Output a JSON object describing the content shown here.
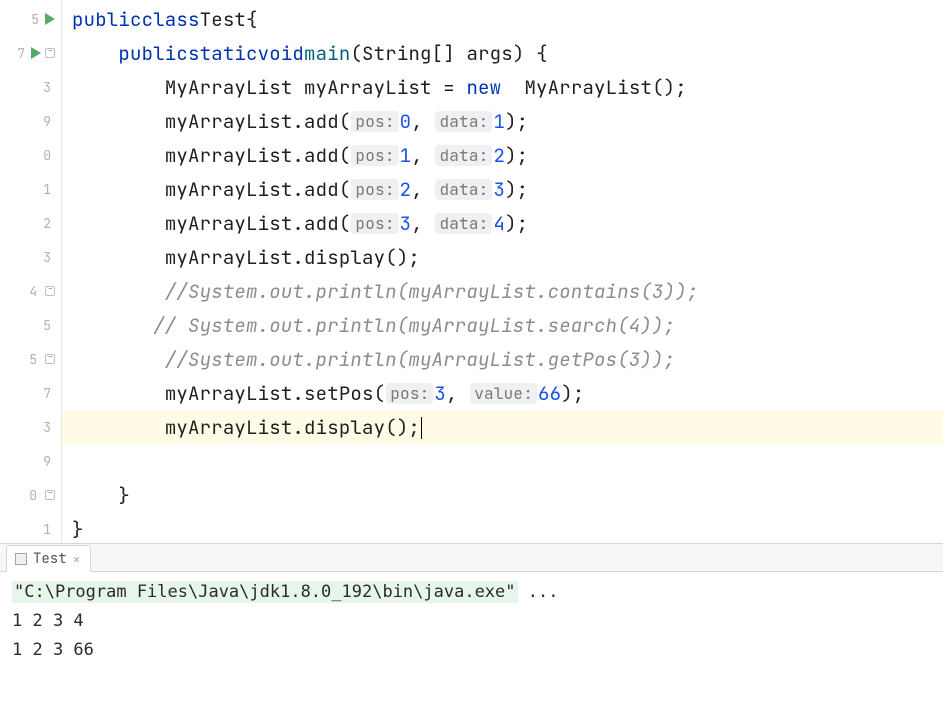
{
  "gutter": {
    "line_numbers": [
      "5",
      "7",
      "3",
      "9",
      "0",
      "1",
      "2",
      "3",
      "4",
      "5",
      "5",
      "7",
      "3",
      "9",
      "0",
      "1"
    ]
  },
  "code": {
    "l1": {
      "indent": "",
      "kw1": "public",
      "kw2": "class",
      "cls": "Test",
      "brace": "{"
    },
    "l2": {
      "indent": "    ",
      "kw1": "public",
      "kw2": "static",
      "kw3": "void",
      "mtd": "main",
      "open": "(",
      "typ": "String",
      "arr": "[] ",
      "par": "args",
      "close": ")",
      "brace": " {"
    },
    "l3": {
      "indent": "        ",
      "cls": "MyArrayList",
      "var": " myArrayList",
      "eq": " = ",
      "kw": "new",
      "sp": "  ",
      "ctor": "MyArrayList",
      "rest": "();"
    },
    "l4": {
      "indent": "        ",
      "call": "myArrayList.add(",
      "hint1": "pos:",
      "num1": "0",
      "sep": ", ",
      "hint2": "data:",
      "num2": "1",
      "end": ");"
    },
    "l5": {
      "indent": "        ",
      "call": "myArrayList.add(",
      "hint1": "pos:",
      "num1": "1",
      "sep": ", ",
      "hint2": "data:",
      "num2": "2",
      "end": ");"
    },
    "l6": {
      "indent": "        ",
      "call": "myArrayList.add(",
      "hint1": "pos:",
      "num1": "2",
      "sep": ", ",
      "hint2": "data:",
      "num2": "3",
      "end": ");"
    },
    "l7": {
      "indent": "        ",
      "call": "myArrayList.add(",
      "hint1": "pos:",
      "num1": "3",
      "sep": ", ",
      "hint2": "data:",
      "num2": "4",
      "end": ");"
    },
    "l8": {
      "indent": "        ",
      "call": "myArrayList.display();"
    },
    "l9": {
      "indent": "        ",
      "cmt": "//System.out.println(myArrayList.contains(3));"
    },
    "l10": {
      "indent": "       ",
      "cmt": "// System.out.println(myArrayList.search(4));"
    },
    "l11": {
      "indent": "        ",
      "cmt": "//System.out.println(myArrayList.getPos(3));"
    },
    "l12": {
      "indent": "        ",
      "call": "myArrayList.setPos(",
      "hint1": "pos:",
      "num1": "3",
      "sep": ", ",
      "hint2": "value:",
      "num2": "66",
      "end": ");"
    },
    "l13": {
      "indent": "        ",
      "call": "myArrayList.display();"
    },
    "l14": {
      "indent": ""
    },
    "l15": {
      "indent": "    ",
      "brace": "}"
    },
    "l16": {
      "indent": "",
      "brace": "}"
    }
  },
  "console": {
    "tab_title": "Test",
    "command": "\"C:\\Program Files\\Java\\jdk1.8.0_192\\bin\\java.exe\"",
    "ellipsis": " ...",
    "out1": "1 2 3 4",
    "out2": "1 2 3 66"
  }
}
